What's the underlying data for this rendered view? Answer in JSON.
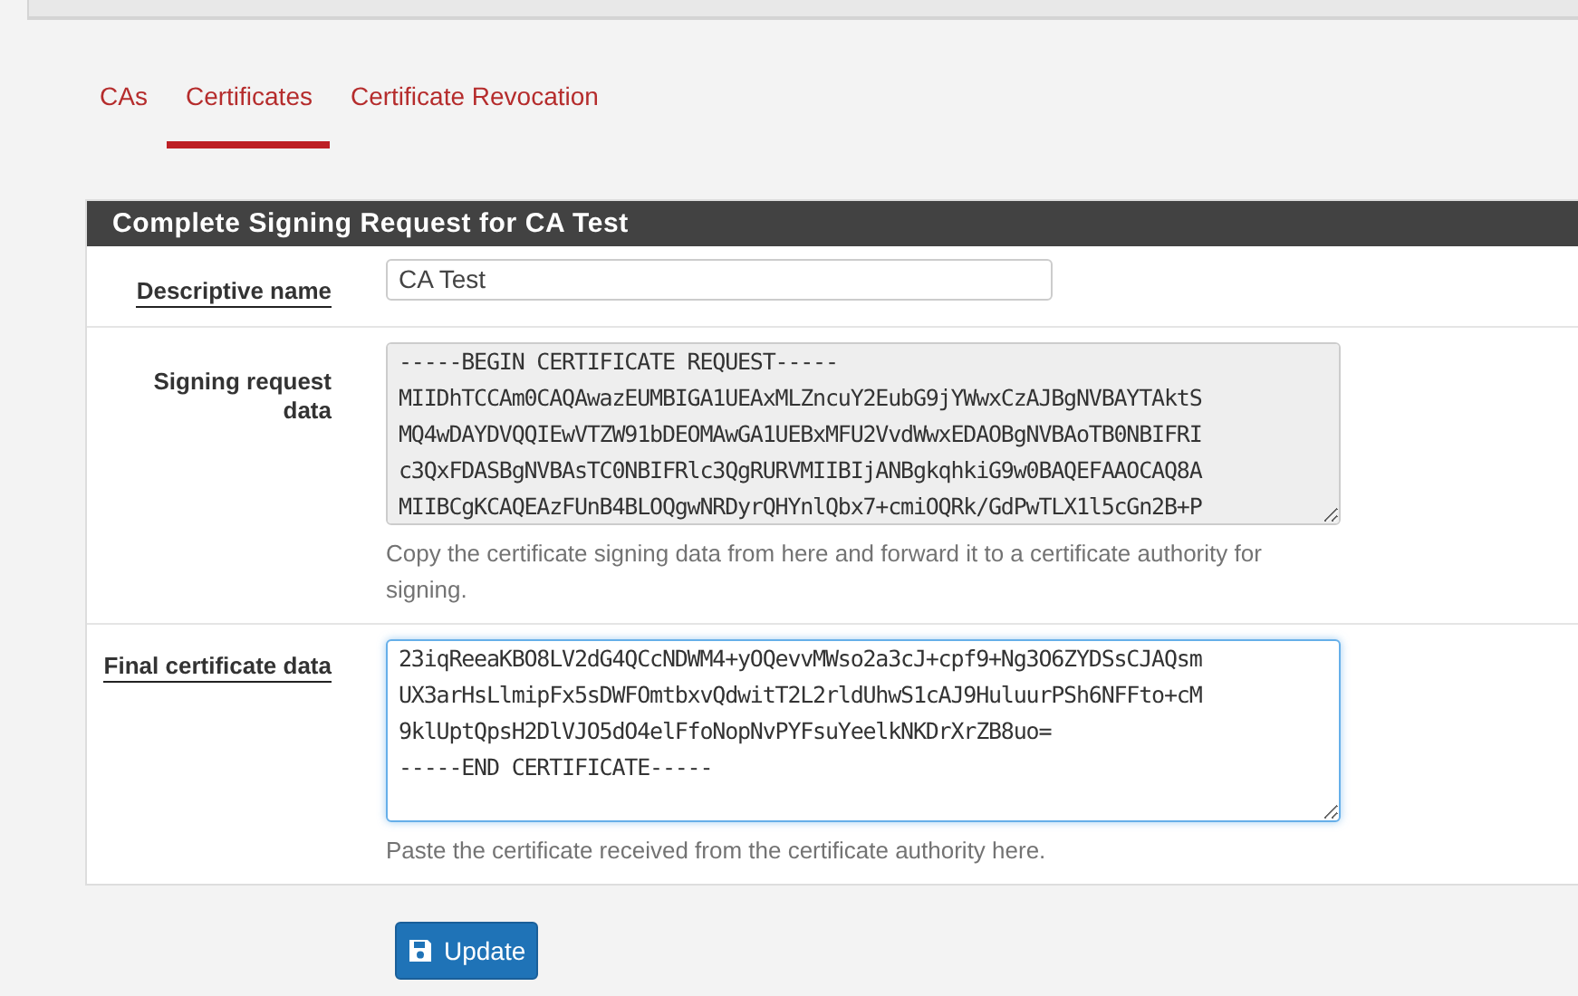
{
  "tabs": [
    {
      "label": "CAs",
      "selected": false
    },
    {
      "label": "Certificates",
      "selected": true
    },
    {
      "label": "Certificate Revocation",
      "selected": false
    }
  ],
  "panel": {
    "title": "Complete Signing Request for CA Test",
    "rows": [
      {
        "kind": "input",
        "label": "Descriptive name",
        "underlined": true,
        "value": "CA Test"
      },
      {
        "kind": "textarea",
        "label": "Signing request data",
        "underlined": false,
        "readonly": true,
        "lines": [
          "-----BEGIN CERTIFICATE REQUEST-----",
          "MIIDhTCCAm0CAQAwazEUMBIGA1UEAxMLZncuY2EubG9jYWwxCzAJBgNVBAYTAktS",
          "MQ4wDAYDVQQIEwVTZW91bDEOMAwGA1UEBxMFU2VvdWwxEDAOBgNVBAoTB0NBIFRI",
          "c3QxFDASBgNVBAsTC0NBIFRlc3QgRURVMIIBIjANBgkqhkiG9w0BAQEFAAOCAQ8A",
          "MIIBCgKCAQEAzFUnB4BLOQgwNRDyrQHYnlQbx7+cmiOQRk/GdPwTLX1l5cGn2B+P"
        ],
        "help": "Copy the certificate signing data from here and forward it to a certificate authority for signing."
      },
      {
        "kind": "textarea",
        "label": "Final certificate data",
        "underlined": true,
        "readonly": false,
        "lines": [
          "23iqReeaKBO8LV2dG4QCcNDWM4+yOQevvMWso2a3cJ+cpf9+Ng3O6ZYDSsCJAQsm",
          "UX3arHsLlmipFx5sDWFOmtbxvQdwitT2L2rldUhwS1cAJ9HuluurPSh6NFFto+cM",
          "9klUptQpsH2DlVJO5dO4elFfoNopNvPYFsuYeelkNKDrXrZB8uo=",
          "-----END CERTIFICATE-----"
        ],
        "help": "Paste the certificate received from the certificate authority here."
      }
    ]
  },
  "button": {
    "label": "Update"
  }
}
